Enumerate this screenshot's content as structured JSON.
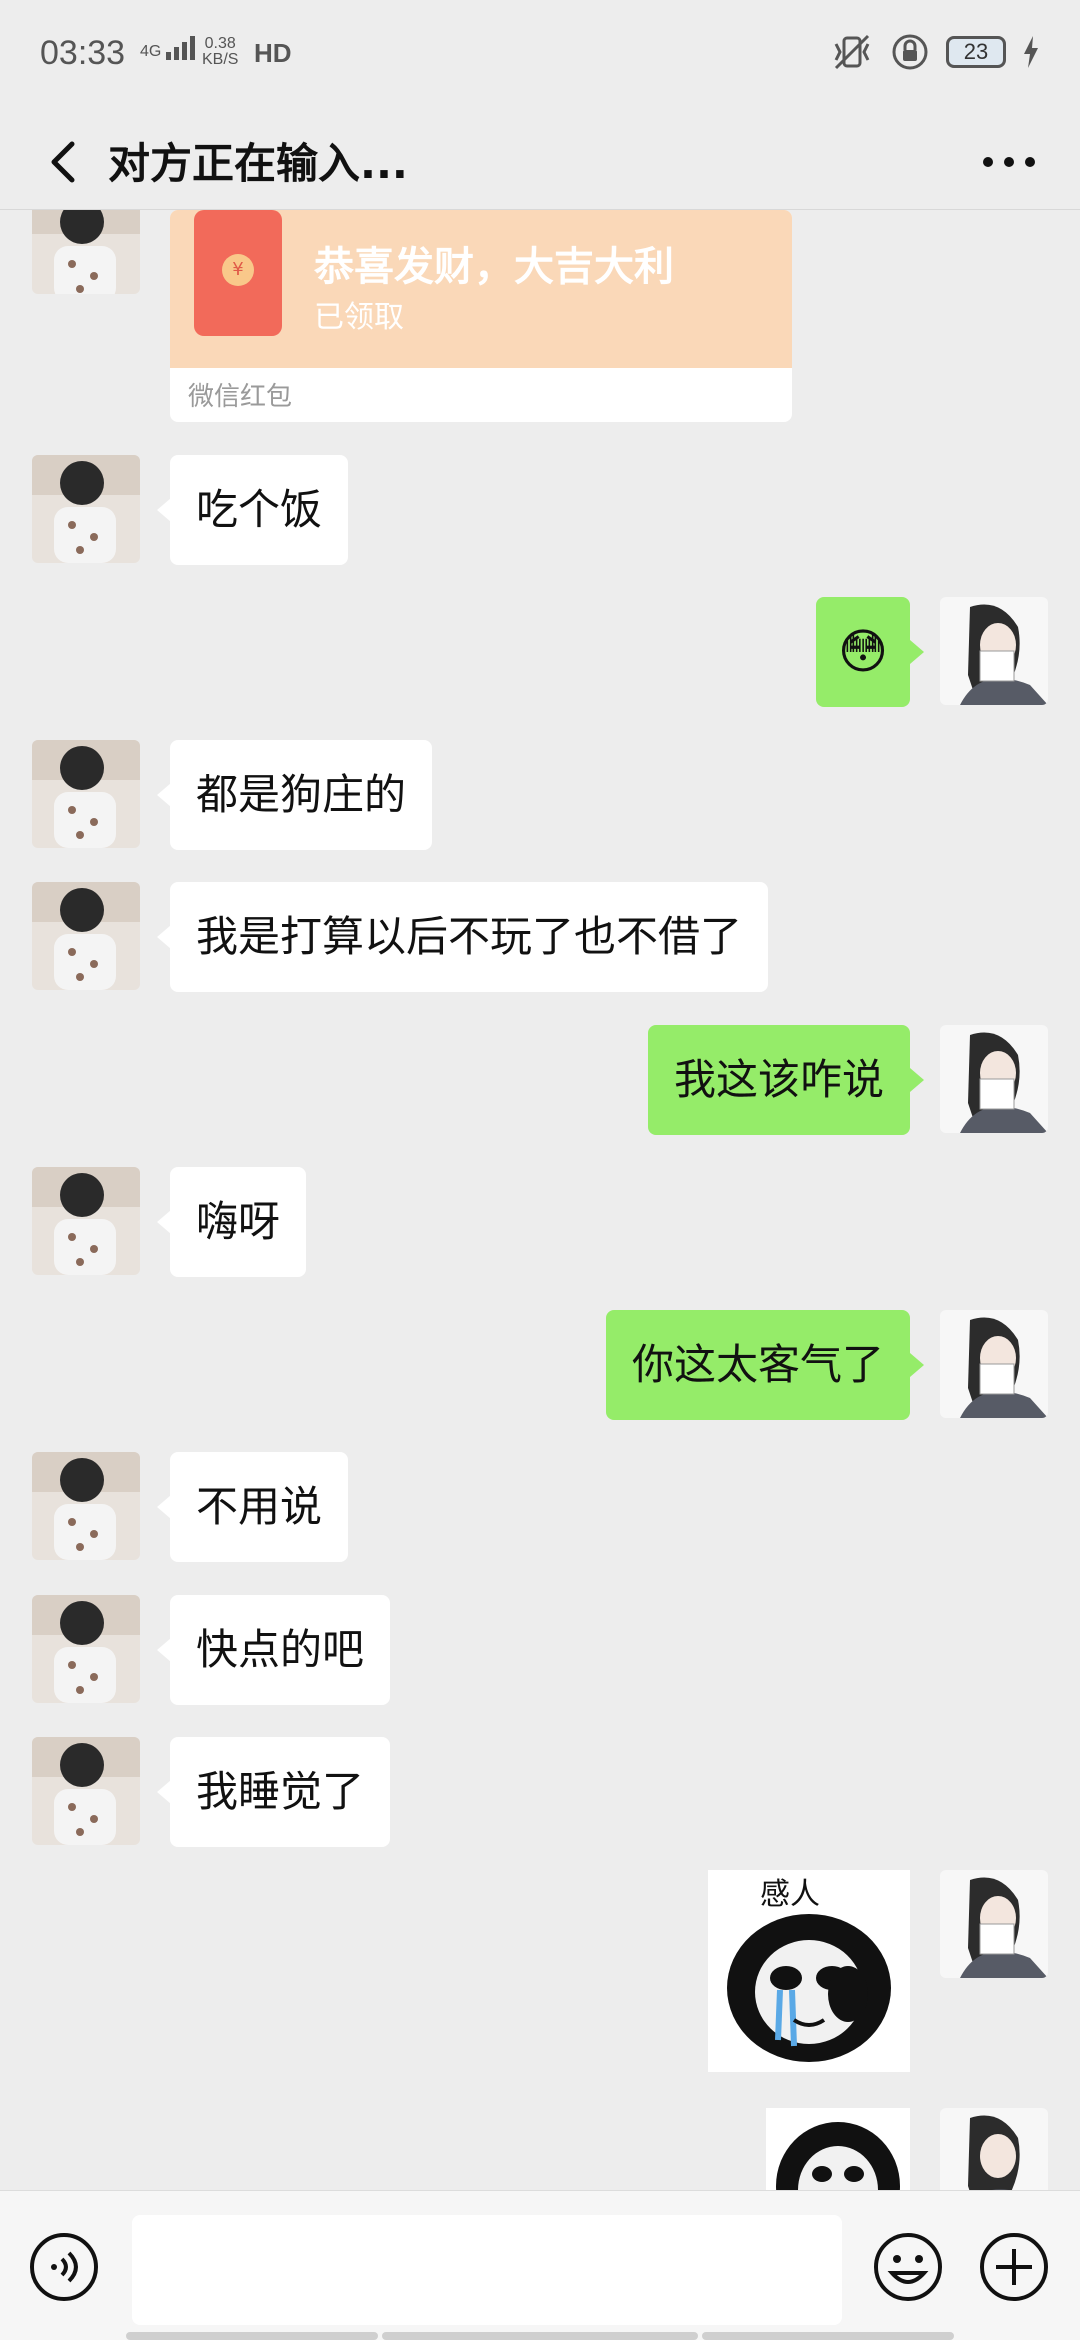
{
  "status_bar": {
    "time": "03:33",
    "network": "4G",
    "speed_value": "0.38",
    "speed_unit": "KB/S",
    "hd": "HD",
    "battery": "23"
  },
  "header": {
    "title": "对方正在输入..."
  },
  "red_packet": {
    "title": "恭喜发财，大吉大利",
    "status": "已领取",
    "label": "微信红包",
    "coin": "¥"
  },
  "messages": [
    {
      "side": "left",
      "text": "吃个饭"
    },
    {
      "side": "right",
      "text": "😳"
    },
    {
      "side": "left",
      "text": "都是狗庄的"
    },
    {
      "side": "left",
      "text": "我是打算以后不玩了也不借了"
    },
    {
      "side": "right",
      "text": "我这该咋说"
    },
    {
      "side": "left",
      "text": "嗨呀"
    },
    {
      "side": "right",
      "text": "你这太客气了"
    },
    {
      "side": "left",
      "text": "不用说"
    },
    {
      "side": "left",
      "text": "快点的吧"
    },
    {
      "side": "left",
      "text": "我睡觉了"
    }
  ],
  "sticker": {
    "caption": "感人"
  },
  "colors": {
    "background": "#ededed",
    "bubble_self": "#95ec69",
    "bubble_other": "#ffffff",
    "red_packet_bg": "#fad8b8",
    "red_packet_icon": "#f26a5a"
  }
}
